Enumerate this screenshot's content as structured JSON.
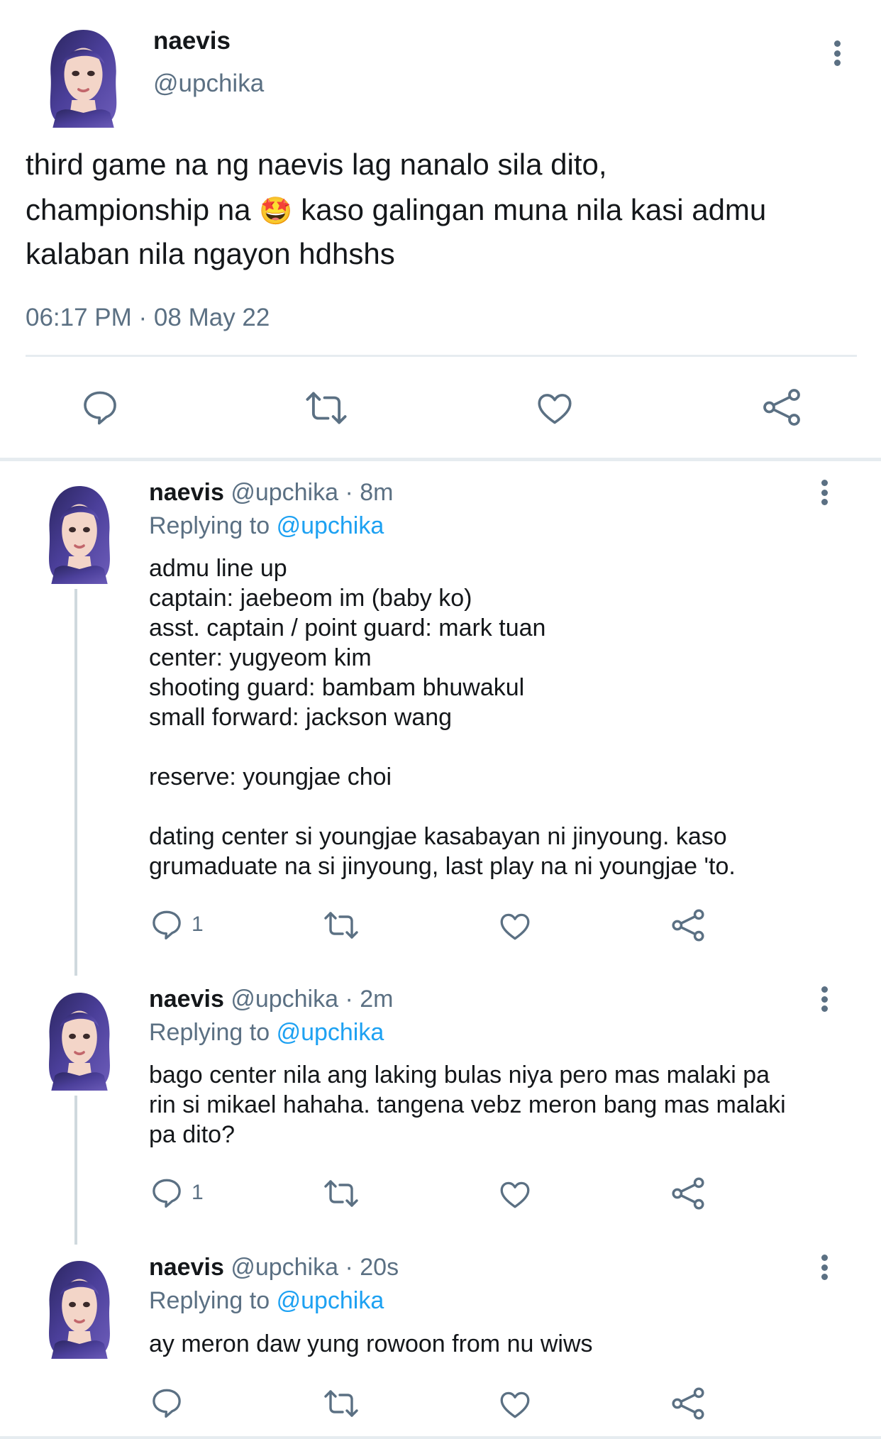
{
  "main_tweet": {
    "name": "naevis",
    "handle": "@upchika",
    "text_line1": "third game na ng naevis lag nanalo sila dito,",
    "text_line2a": "championship na ",
    "emoji": "🤩",
    "text_line2b": " kaso galingan muna nila kasi admu",
    "text_line3": "kalaban nila ngayon hdhshs",
    "timestamp": "06:17 PM · 08 May 22",
    "actions": [
      "reply-icon",
      "retweet-icon",
      "like-icon",
      "share-icon"
    ]
  },
  "replies": [
    {
      "name": "naevis",
      "handle": "@upchika",
      "time": "· 8m",
      "replying_label": "Replying to",
      "replying_to": "@upchika",
      "text": "admu line up\ncaptain: jaebeom im (baby ko)\nasst. captain / point guard: mark tuan\ncenter: yugyeom kim\nshooting guard: bambam bhuwakul\nsmall forward: jackson wang\n\nreserve: youngjae choi\n\ndating center si youngjae kasabayan ni jinyoung. kaso\ngrumaduate na si jinyoung, last play na ni youngjae 'to.",
      "reply_count": "1"
    },
    {
      "name": "naevis",
      "handle": "@upchika",
      "time": "· 2m",
      "replying_label": "Replying to",
      "replying_to": "@upchika",
      "text": "bago center nila ang laking bulas niya pero mas malaki pa\nrin si mikael hahaha. tangena vebz meron bang mas malaki\npa dito?",
      "reply_count": "1"
    },
    {
      "name": "naevis",
      "handle": "@upchika",
      "time": "· 20s",
      "replying_label": "Replying to",
      "replying_to": "@upchika",
      "text": "ay meron daw yung rowoon from nu wiws",
      "reply_count": ""
    }
  ],
  "colors": {
    "text": "#14171a",
    "muted": "#5b7083",
    "link": "#1da1f2",
    "divider": "#e6ecf0",
    "hair": "#4a3f8f"
  }
}
